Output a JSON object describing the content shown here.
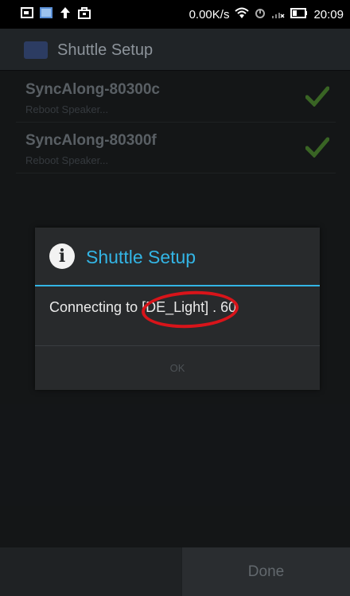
{
  "status_bar": {
    "left_icons": [
      "image-icon",
      "app-icon",
      "upload-arrow-icon",
      "bag-icon"
    ],
    "net_speed": "0.00K/s",
    "right_icons": [
      "wifi-icon",
      "nfc-icon",
      "signal-icon",
      "battery-icon"
    ],
    "time": "20:09"
  },
  "action_bar": {
    "title": "Shuttle Setup"
  },
  "devices": [
    {
      "name": "SyncAlong-80300c",
      "status": "Reboot Speaker...",
      "checked": true
    },
    {
      "name": "SyncAlong-80300f",
      "status": "Reboot Speaker...",
      "checked": true
    }
  ],
  "dialog": {
    "title": "Shuttle Setup",
    "message": "Connecting to [DE_Light]  . 60",
    "ok_label": "OK"
  },
  "bottom_bar": {
    "done_label": "Done"
  },
  "colors": {
    "accent": "#33b5e5",
    "highlight": "#d8141a",
    "check": "#5aa83a"
  }
}
